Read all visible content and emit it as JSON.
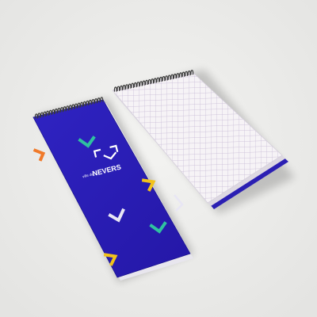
{
  "cover": {
    "brand_prefix": "ville de",
    "brand_name": "NEVERS"
  },
  "colors": {
    "background": "#ececea",
    "cover_blue": "#2b1fb3",
    "cover_edge": "#1d1590",
    "grid_paper": "#f6f3f6",
    "grid_line": "#c9bcd6",
    "spiral": "#3a3a3a",
    "chevron_orange": "#f07a2a",
    "chevron_green": "#2fc1a0",
    "chevron_yellow": "#f2c21a",
    "chevron_white": "#e8e6f4"
  }
}
